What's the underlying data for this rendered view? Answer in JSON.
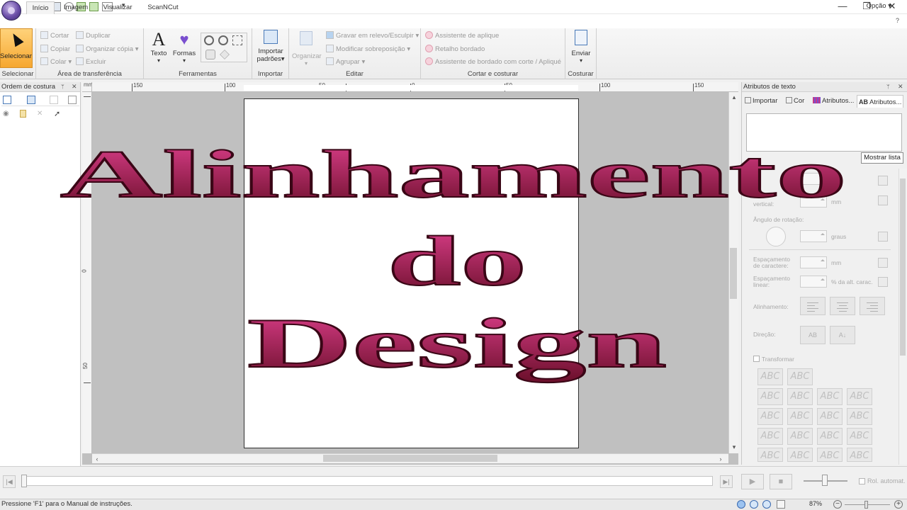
{
  "quick_access": [
    "new-file-icon",
    "open-folder-icon",
    "save-icon",
    "zoom-icon",
    "undo-icon",
    "redo-icon",
    "display-icon"
  ],
  "window": {
    "minimize": "—",
    "maximize": "❐",
    "close": "✕"
  },
  "tabs": [
    {
      "label": "Início",
      "active": true
    },
    {
      "label": "Imagem",
      "active": false
    },
    {
      "label": "Visualizar",
      "active": false
    },
    {
      "label": "ScanNCut",
      "active": false
    }
  ],
  "options_label": "Opção",
  "ribbon": {
    "selecionar": {
      "button": "Selecionar",
      "group": "Selecionar"
    },
    "clipboard": {
      "group": "Área de transferência",
      "cortar": "Cortar",
      "copiar": "Copiar",
      "colar": "Colar",
      "duplicar": "Duplicar",
      "organizar_copia": "Organizar cópia",
      "excluir": "Excluir"
    },
    "tools": {
      "group": "Ferramentas",
      "texto": "Texto",
      "formas": "Formas"
    },
    "import": {
      "group": "Importar",
      "line1": "Importar",
      "line2": "padrões"
    },
    "edit": {
      "group": "Editar",
      "organizar": "Organizar",
      "gravar": "Gravar em relevo/Esculpir",
      "modificar": "Modificar sobreposição",
      "agrupar": "Agrupar"
    },
    "cut_sew": {
      "group": "Cortar e costurar",
      "assist_aplique": "Assistente de aplique",
      "retalho": "Retalho bordado",
      "assist_bordado": "Assistente de bordado com corte / Apliqué"
    },
    "sew": {
      "group": "Costurar",
      "enviar": "Enviar"
    }
  },
  "left_panel": {
    "title": "Ordem de costura"
  },
  "ruler_h_labels": [
    "150",
    "100",
    "50",
    "0",
    "50",
    "100",
    "150"
  ],
  "ruler_v_labels": [
    "0",
    "50"
  ],
  "right_panel": {
    "title": "Atributos de texto",
    "tabs": [
      "Importar",
      "Cor",
      "Atributos...",
      "Atributos..."
    ],
    "show_list": "Mostrar lista",
    "vertical_label": "vertical:",
    "unit_mm": "mm",
    "rotation_label": "Ângulo de rotação:",
    "unit_graus": "graus",
    "char_spacing": [
      "Espaçamento",
      "de caractere:"
    ],
    "line_spacing": [
      "Espaçamento",
      "linear:"
    ],
    "unit_pct": "% da alt. carac.",
    "alignment_label": "Alinhamento:",
    "direction_label": "Direção:",
    "dir_btn1": "AB",
    "transform_label": "Transformar",
    "abc": "ABC"
  },
  "playback": {
    "auto_roll": "Rol. automat."
  },
  "status": {
    "text": "Pressione 'F1' para o Manual de instruções.",
    "zoom": "87%"
  },
  "overlay": {
    "line1": "Alinhamento",
    "line2": "do",
    "line3": "Design",
    "color_top": "#e0408e",
    "color_bottom": "#6a0f2a"
  }
}
